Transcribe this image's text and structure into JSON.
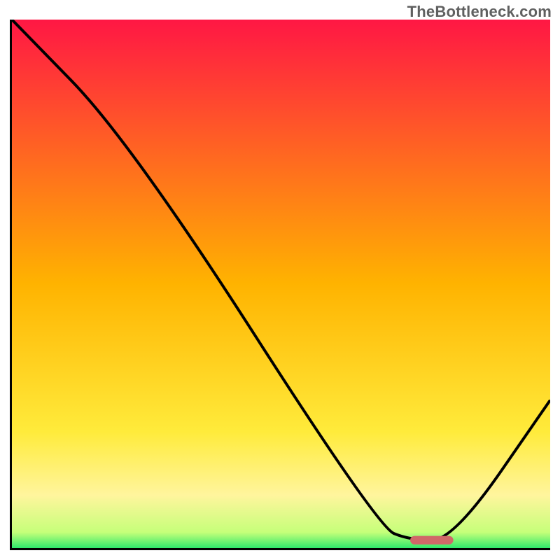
{
  "watermark": "TheBottleneck.com",
  "chart_data": {
    "type": "line",
    "title": "",
    "xlabel": "",
    "ylabel": "",
    "xlim": [
      0,
      100
    ],
    "ylim": [
      0,
      100
    ],
    "grid": false,
    "legend": false,
    "series": [
      {
        "name": "bottleneck-curve",
        "x": [
          0,
          22,
          68,
          74,
          82,
          100
        ],
        "values": [
          100,
          77,
          4,
          1.5,
          1.5,
          28
        ]
      }
    ],
    "marker": {
      "name": "optimal-range-bar",
      "x_start": 74,
      "x_end": 82,
      "y": 1.5,
      "color": "#d06868"
    },
    "background": {
      "type": "vertical-gradient",
      "stops": [
        {
          "pos": 0.0,
          "color": "#ff1744"
        },
        {
          "pos": 0.5,
          "color": "#ffb300"
        },
        {
          "pos": 0.78,
          "color": "#ffeb3b"
        },
        {
          "pos": 0.9,
          "color": "#fff59d"
        },
        {
          "pos": 0.97,
          "color": "#c6ff7a"
        },
        {
          "pos": 1.0,
          "color": "#2ee86b"
        }
      ]
    }
  }
}
